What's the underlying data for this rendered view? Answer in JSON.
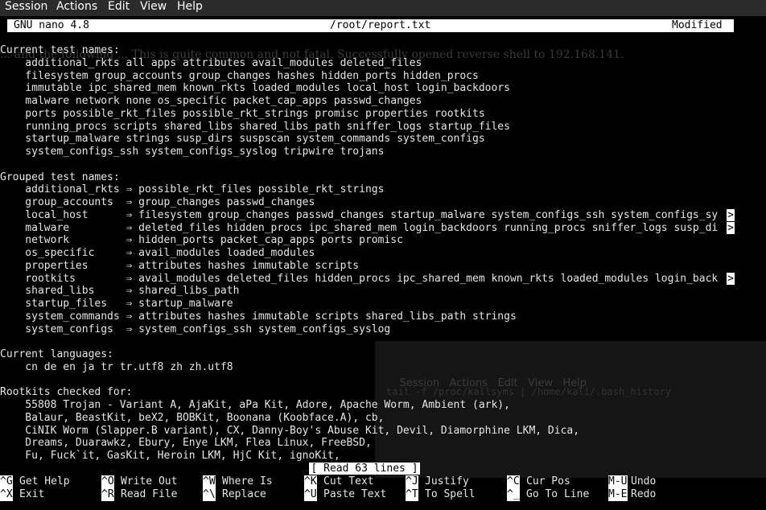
{
  "menu": [
    "Session",
    "Actions",
    "Edit",
    "View",
    "Help"
  ],
  "title": {
    "app": "GNU nano 4.8",
    "file": "/root/report.txt",
    "state": "Modified"
  },
  "background_ghost": {
    "overlay_text": "... and the following ... This is quite common and not fatal. Successfully opened reverse shell to 192.168.141.",
    "window_menu": [
      "Session",
      "Actions",
      "Edit",
      "View",
      "Help"
    ],
    "window_line": "tail -f /proc/kallsyms | /home/kali/.bash_history"
  },
  "lines": [
    "Current test names:",
    "    additional_rkts all apps attributes avail_modules deleted_files",
    "    filesystem group_accounts group_changes hashes hidden_ports hidden_procs",
    "    immutable ipc_shared_mem known_rkts loaded_modules local_host login_backdoors",
    "    malware network none os_specific packet_cap_apps passwd_changes",
    "    ports possible_rkt_files possible_rkt_strings promisc properties rootkits",
    "    running_procs scripts shared_libs shared_libs_path sniffer_logs startup_files",
    "    startup_malware strings susp_dirs suspscan system_commands system_configs",
    "    system_configs_ssh system_configs_syslog tripwire trojans",
    "",
    "Grouped test names:",
    "    additional_rkts ⇒ possible_rkt_files possible_rkt_strings",
    "    group_accounts  ⇒ group_changes passwd_changes",
    "    local_host      ⇒ filesystem group_changes passwd_changes startup_malware system_configs_ssh system_configs_sy",
    "    malware         ⇒ deleted_files hidden_procs ipc_shared_mem login_backdoors running_procs sniffer_logs susp_di",
    "    network         ⇒ hidden_ports packet_cap_apps ports promisc",
    "    os_specific     ⇒ avail_modules loaded_modules",
    "    properties      ⇒ attributes hashes immutable scripts",
    "    rootkits        ⇒ avail_modules deleted_files hidden_procs ipc_shared_mem known_rkts loaded_modules login_back",
    "    shared_libs     ⇒ shared_libs_path",
    "    startup_files   ⇒ startup_malware",
    "    system_commands ⇒ attributes hashes immutable scripts shared_libs_path strings",
    "    system_configs  ⇒ system_configs_ssh system_configs_syslog",
    "",
    "Current languages:",
    "    cn de en ja tr tr.utf8 zh zh.utf8",
    "",
    "Rootkits checked for:",
    "    55808 Trojan - Variant A, AjaKit, aPa Kit, Adore, Apache Worm, Ambient (ark),",
    "    Balaur, BeastKit, beX2, BOBKit, Boonana (Koobface.A), cb,",
    "    CiNIK Worm (Slapper.B variant), CX, Danny-Boy's Abuse Kit, Devil, Diamorphine LKM, Dica,",
    "    Dreams, Duarawkz, Ebury, Enye LKM, Flea Linux, FreeBSD,",
    "    Fu, Fuck`it, GasKit, Heroin LKM, HjC Kit, ignoKit,"
  ],
  "truncation_marker": ">",
  "status_message": "[ Read 63 lines ]",
  "shortcuts_row1": [
    {
      "key": "^G",
      "label": "Get Help"
    },
    {
      "key": "^O",
      "label": "Write Out"
    },
    {
      "key": "^W",
      "label": "Where Is"
    },
    {
      "key": "^K",
      "label": "Cut Text"
    },
    {
      "key": "^J",
      "label": "Justify"
    },
    {
      "key": "^C",
      "label": "Cur Pos"
    },
    {
      "key": "M-U",
      "label": "Undo"
    }
  ],
  "shortcuts_row2": [
    {
      "key": "^X",
      "label": "Exit"
    },
    {
      "key": "^R",
      "label": "Read File"
    },
    {
      "key": "^\\",
      "label": "Replace"
    },
    {
      "key": "^U",
      "label": "Paste Text"
    },
    {
      "key": "^T",
      "label": "To Spell"
    },
    {
      "key": "^_",
      "label": "Go To Line"
    },
    {
      "key": "M-E",
      "label": "Redo"
    }
  ],
  "colors": {
    "menubar": "#2b2b2b",
    "background": "#000000",
    "text": "#e6e6e6",
    "inverse": "#ffffff"
  }
}
